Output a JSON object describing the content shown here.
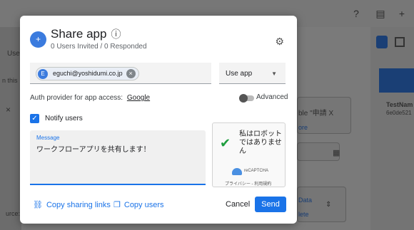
{
  "background": {
    "left_label": "Use",
    "left_label_2": "n this",
    "left_close": "×",
    "card_text": "ble \"申請 X",
    "card_link": "ore",
    "data_button": "Data",
    "delete_button": "lete",
    "right_title": "TestNam",
    "right_sub": "6e0de521",
    "source_label": "urce:"
  },
  "dialog": {
    "title": "Share app",
    "subtitle": "0 Users Invited / 0 Responded",
    "icons": {
      "header": "add-person-icon",
      "info": "info-icon",
      "settings": "gear-icon"
    }
  },
  "invite": {
    "email": "eguchi@yoshidumi.co.jp",
    "avatar_letter": "E",
    "role_value": "Use app"
  },
  "auth": {
    "label": "Auth provider for app access:",
    "provider": "Google",
    "advanced_label": "Advanced"
  },
  "notify": {
    "label": "Notify users",
    "checked": true
  },
  "message": {
    "label": "Message",
    "value": "ワークフローアプリを共有します！"
  },
  "captcha": {
    "text": "私はロボットではありません",
    "brand": "reCAPTCHA",
    "privacy": "プライバシー - 利用規約"
  },
  "footer": {
    "copy_links": "Copy sharing links",
    "copy_users": "Copy users",
    "cancel": "Cancel",
    "send": "Send"
  },
  "colors": {
    "accent": "#1a73e8",
    "captcha_check": "#1e9e3e"
  }
}
